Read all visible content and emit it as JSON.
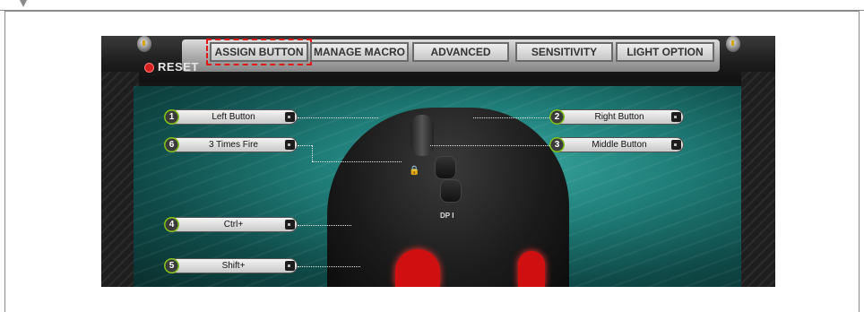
{
  "app": {
    "reset_label": "RESET",
    "tabs": [
      {
        "label": "ASSIGN BUTTON",
        "active": true
      },
      {
        "label": "MANAGE MACRO",
        "active": false
      },
      {
        "label": "ADVANCED",
        "active": false
      },
      {
        "label": "SENSITIVITY",
        "active": false
      },
      {
        "label": "LIGHT OPTION",
        "active": false
      }
    ],
    "mouse_labels": {
      "dpi": "DP I"
    },
    "assignments": [
      {
        "number": "1",
        "value": "Left Button"
      },
      {
        "number": "6",
        "value": "3 Times Fire"
      },
      {
        "number": "4",
        "value": "Ctrl+"
      },
      {
        "number": "5",
        "value": "Shift+"
      },
      {
        "number": "2",
        "value": "Right Button"
      },
      {
        "number": "3",
        "value": "Middle Button"
      }
    ]
  },
  "colors": {
    "accent_red": "#d01010",
    "panel_teal": "#1f7d78",
    "badge_green": "#8bd11a",
    "highlight_dashed": "#e01818"
  }
}
